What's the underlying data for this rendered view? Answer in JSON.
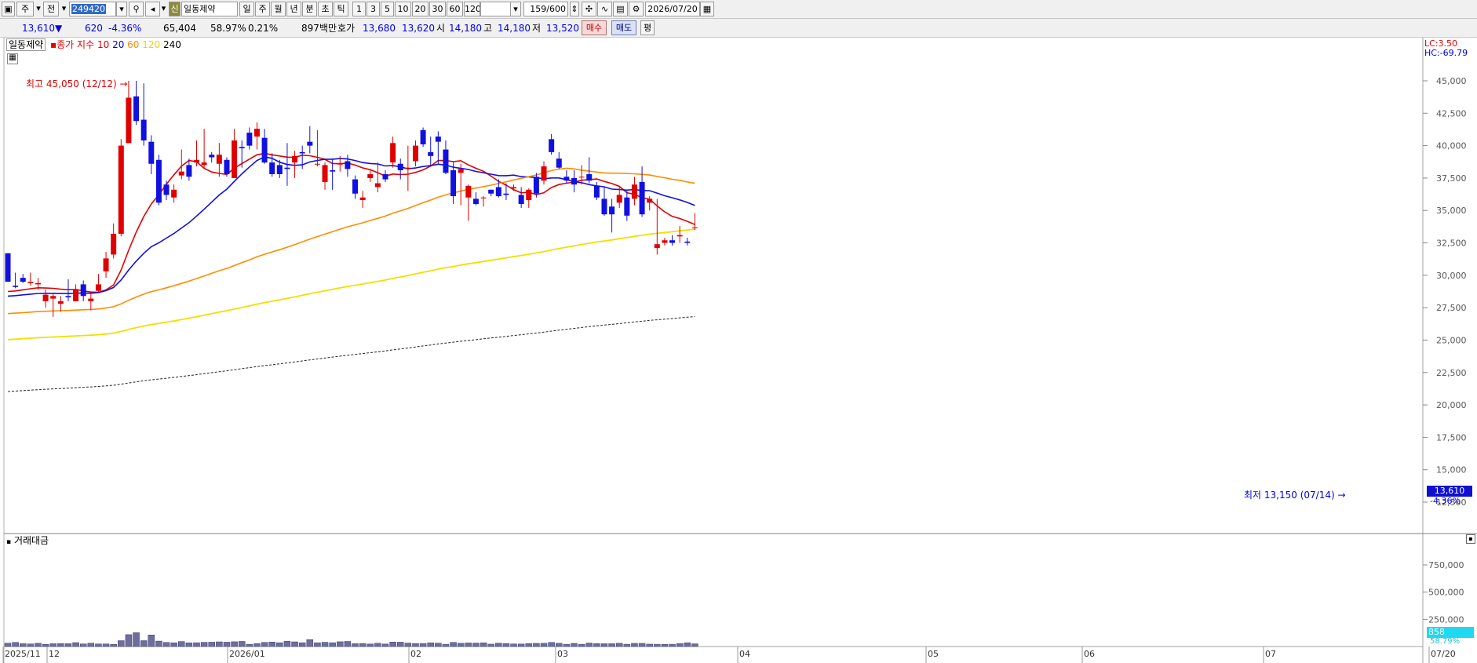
{
  "toolbar": {
    "period_unit": "주",
    "prev_label": "전",
    "code": "249420",
    "name_badge": "신",
    "stock_name": "일동제약",
    "period_tabs": [
      "일",
      "주",
      "월",
      "년",
      "분",
      "초",
      "틱"
    ],
    "active_period": "일",
    "intervals": [
      "1",
      "3",
      "5",
      "10",
      "20",
      "30",
      "60",
      "120"
    ],
    "count": "159/600",
    "date": "2026/07/20"
  },
  "quote": {
    "price": "13,610",
    "change_arrow": "▼",
    "change": "620",
    "change_pct": "-4.36%",
    "volume": "65,404",
    "turnover_pct": "58.97%",
    "foreign_pct": "0.21%",
    "amount": "897백만",
    "ask_label": "호가",
    "ask1": "13,680",
    "ask2": "13,620",
    "open_label": "시",
    "open": "14,180",
    "high_label": "고",
    "high": "14,180",
    "low_label": "저",
    "low": "13,520",
    "buy_label": "매수",
    "sell_label": "매도",
    "eval_label": "평"
  },
  "legend": {
    "name": "일동제약",
    "series_label": "종가 지수",
    "ma": [
      {
        "period": "10",
        "color": "#e00000"
      },
      {
        "period": "20",
        "color": "#0000e0"
      },
      {
        "period": "60",
        "color": "#ff8c00"
      },
      {
        "period": "120",
        "color": "#f0e000"
      },
      {
        "period": "240",
        "color": "#000000"
      }
    ]
  },
  "corner": {
    "lc": "LC:3.50",
    "hc": "HC:-69.79"
  },
  "annotations": {
    "high": "최고 45,050 (12/12)",
    "low": "최저 13,150 (07/14)",
    "last_price": "13,610",
    "last_change": "-4.36%",
    "vol_last": "858",
    "vol_pct": "58.79%"
  },
  "volume_panel": {
    "title": "거래대금"
  },
  "chart_data": {
    "type": "candlestick",
    "price_axis": [
      "45,000",
      "42,500",
      "40,000",
      "37,500",
      "35,000",
      "32,500",
      "30,000",
      "27,500",
      "25,000",
      "22,500",
      "20,000",
      "17,500",
      "15,000",
      "12,500"
    ],
    "volume_axis": [
      "750,000",
      "500,000",
      "250,000"
    ],
    "x_labels": [
      "2025/11",
      "12",
      "2026/01",
      "02",
      "03",
      "04",
      "05",
      "06",
      "07",
      "07/20"
    ],
    "ohlc": [
      [
        31700,
        31700,
        31100,
        29500
      ],
      [
        29200,
        30200,
        29000,
        29100
      ],
      [
        29800,
        30100,
        29400,
        29500
      ],
      [
        29400,
        30200,
        29200,
        29500
      ],
      [
        29300,
        29800,
        28900,
        29400
      ],
      [
        28000,
        28900,
        27500,
        28500
      ],
      [
        28200,
        28600,
        26800,
        28400
      ],
      [
        27800,
        28400,
        27200,
        28000
      ],
      [
        28400,
        29700,
        28000,
        28300
      ],
      [
        28000,
        29300,
        28000,
        28900
      ],
      [
        29300,
        29600,
        28000,
        28400
      ],
      [
        28000,
        28600,
        27300,
        28200
      ],
      [
        28800,
        30100,
        28700,
        29300
      ],
      [
        30300,
        31800,
        29800,
        31300
      ],
      [
        31600,
        34000,
        31300,
        33200
      ],
      [
        33200,
        40500,
        33000,
        40000
      ],
      [
        40200,
        45000,
        40200,
        43700
      ],
      [
        43800,
        45000,
        41600,
        41900
      ],
      [
        42000,
        44800,
        40000,
        40400
      ],
      [
        40300,
        40800,
        37800,
        38600
      ],
      [
        38900,
        39300,
        35400,
        35600
      ],
      [
        37000,
        37300,
        35800,
        36200
      ],
      [
        36000,
        37000,
        35600,
        36600
      ],
      [
        37700,
        39700,
        37400,
        38000
      ],
      [
        38500,
        39000,
        37300,
        37600
      ],
      [
        38700,
        40400,
        38400,
        38900
      ],
      [
        38500,
        41300,
        38200,
        38700
      ],
      [
        39300,
        39500,
        38700,
        39100
      ],
      [
        38600,
        40200,
        37600,
        39300
      ],
      [
        38900,
        39100,
        37600,
        37800
      ],
      [
        37500,
        41300,
        37500,
        40400
      ],
      [
        39900,
        40400,
        38300,
        39800
      ],
      [
        41000,
        41400,
        39700,
        40000
      ],
      [
        40700,
        41800,
        39700,
        41300
      ],
      [
        40600,
        41300,
        38600,
        38700
      ],
      [
        38700,
        39400,
        37600,
        37800
      ],
      [
        38500,
        38900,
        37500,
        37800
      ],
      [
        38300,
        40200,
        36900,
        38200
      ],
      [
        38700,
        39600,
        37500,
        39200
      ],
      [
        39500,
        40000,
        38200,
        39400
      ],
      [
        40300,
        41500,
        39400,
        40000
      ],
      [
        38600,
        41200,
        38400,
        38600
      ],
      [
        37200,
        38700,
        36600,
        38500
      ],
      [
        38100,
        39000,
        36600,
        38000
      ],
      [
        38600,
        39200,
        38000,
        38600
      ],
      [
        38800,
        39300,
        37600,
        38200
      ],
      [
        37400,
        37700,
        35900,
        36300
      ],
      [
        35800,
        36500,
        35200,
        36000
      ],
      [
        37500,
        38200,
        37200,
        37800
      ],
      [
        36800,
        38700,
        36400,
        37100
      ],
      [
        37800,
        38100,
        37200,
        37400
      ],
      [
        38700,
        40700,
        38300,
        40200
      ],
      [
        38600,
        39000,
        37400,
        38100
      ],
      [
        38200,
        40000,
        36500,
        38300
      ],
      [
        38800,
        40400,
        38400,
        40000
      ],
      [
        41200,
        41400,
        39900,
        40100
      ],
      [
        39500,
        40700,
        38400,
        39200
      ],
      [
        40700,
        41100,
        38600,
        40300
      ],
      [
        39700,
        40400,
        37800,
        37900
      ],
      [
        38100,
        38700,
        35500,
        36100
      ],
      [
        37900,
        38600,
        35400,
        38200
      ],
      [
        36000,
        37000,
        34200,
        36900
      ],
      [
        35900,
        36400,
        35400,
        35500
      ],
      [
        36000,
        36100,
        35300,
        36000
      ],
      [
        36600,
        36600,
        36100,
        36300
      ],
      [
        36800,
        37400,
        36000,
        36100
      ],
      [
        36300,
        37100,
        35800,
        36200
      ],
      [
        36700,
        37000,
        36500,
        36800
      ],
      [
        36200,
        36800,
        35200,
        35500
      ],
      [
        35800,
        36700,
        35200,
        36600
      ],
      [
        37600,
        37900,
        36000,
        36300
      ],
      [
        37300,
        38800,
        37000,
        38400
      ],
      [
        40500,
        40900,
        39300,
        39500
      ],
      [
        39000,
        39500,
        38200,
        38300
      ],
      [
        37600,
        38100,
        37100,
        37300
      ],
      [
        37500,
        38100,
        36400,
        37000
      ],
      [
        37600,
        38500,
        37000,
        37600
      ],
      [
        37800,
        39100,
        37100,
        37300
      ],
      [
        36900,
        37200,
        35800,
        36000
      ],
      [
        35900,
        36800,
        34600,
        34700
      ],
      [
        35300,
        35900,
        33300,
        34700
      ],
      [
        35600,
        36800,
        35200,
        36200
      ],
      [
        36000,
        36500,
        34200,
        34600
      ],
      [
        35900,
        37600,
        35400,
        37000
      ],
      [
        37200,
        38400,
        34500,
        34700
      ],
      [
        35600,
        36100,
        35000,
        35900
      ],
      [
        32100,
        35900,
        31600,
        32400
      ],
      [
        32500,
        32900,
        32300,
        32700
      ],
      [
        32700,
        33100,
        32300,
        32500
      ],
      [
        33000,
        33800,
        32500,
        33100
      ],
      [
        32600,
        32900,
        32300,
        32500
      ],
      [
        33700,
        34800,
        33500,
        33700
      ]
    ],
    "volume": [
      31000,
      38000,
      26000,
      24000,
      30000,
      20000,
      26000,
      28000,
      26000,
      36000,
      24000,
      31000,
      24000,
      24000,
      20000,
      54000,
      109000,
      127000,
      54000,
      106000,
      50000,
      38000,
      34000,
      46000,
      34000,
      35000,
      39000,
      40000,
      43000,
      40000,
      44000,
      47000,
      21000,
      27000,
      38000,
      41000,
      35000,
      48000,
      43000,
      35000,
      64000,
      35000,
      39000,
      35000,
      44000,
      47000,
      26000,
      27000,
      23000,
      30000,
      23000,
      41000,
      40000,
      32000,
      28000,
      28000,
      34000,
      31000,
      21000,
      38000,
      30000,
      33000,
      32000,
      34000,
      22000,
      31000,
      27000,
      24000,
      23000,
      27000,
      29000,
      30000,
      38000,
      30000,
      21000,
      29000,
      21000,
      32000,
      27000,
      26000,
      26000,
      30000,
      21000,
      29000,
      29000,
      22000,
      21000,
      20000,
      21000,
      28000,
      35000,
      25000
    ]
  }
}
